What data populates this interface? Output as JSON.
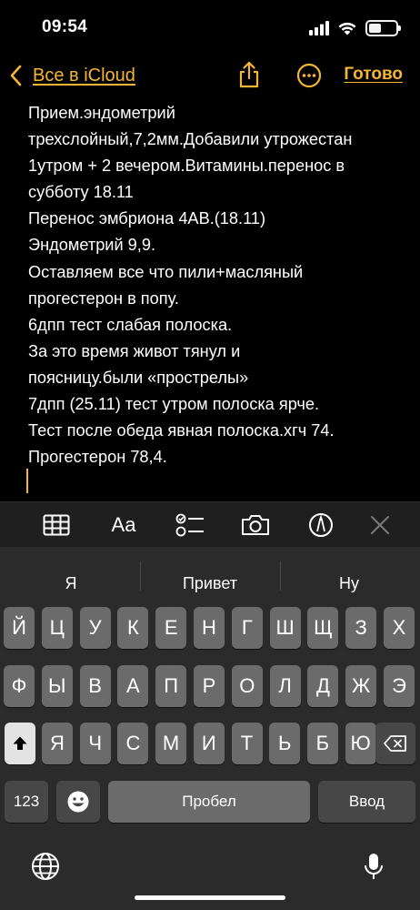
{
  "status_bar": {
    "time": "09:54",
    "battery_level": 0.45
  },
  "nav": {
    "back_label": "Все в iCloud",
    "done_label": "Готово"
  },
  "note": {
    "lines": [
      "Прием.эндометрий",
      "трехслойный,7,2мм.Добавили утрожестан",
      "1утром + 2 вечером.Витамины.перенос в",
      "субботу 18.11",
      "Перенос эмбриона 4АВ.(18.11)",
      "Эндометрий 9,9.",
      "Оставляем все что пили+масляный",
      "прогестерон в попу.",
      "6дпп тест слабая полоска.",
      "За это время живот тянул и",
      "поясницу.были «прострелы»",
      "7дпп  (25.11) тест утром полоска ярче.",
      "Тест после обеда явная полоска.хгч 74.",
      "Прогестерон 78,4."
    ]
  },
  "format_toolbar": {
    "items": [
      "table-icon",
      "Aa",
      "checklist-icon",
      "camera-icon",
      "markup-icon",
      "close-icon"
    ],
    "format_label": "Aa"
  },
  "keyboard": {
    "suggestions": [
      "Я",
      "Привет",
      "Ну"
    ],
    "row1": [
      "Й",
      "Ц",
      "У",
      "К",
      "Е",
      "Н",
      "Г",
      "Ш",
      "Щ",
      "З",
      "Х"
    ],
    "row2": [
      "Ф",
      "Ы",
      "В",
      "А",
      "П",
      "Р",
      "О",
      "Л",
      "Д",
      "Ж",
      "Э"
    ],
    "row3": [
      "Я",
      "Ч",
      "С",
      "М",
      "И",
      "Т",
      "Ь",
      "Б",
      "Ю"
    ],
    "numbers_label": "123",
    "space_label": "Пробел",
    "return_label": "Ввод"
  },
  "colors": {
    "accent": "#f5b731",
    "background": "#000000",
    "keyboard_bg": "#2b2b2b",
    "key": "#6b6b6b",
    "key_dark": "#474747"
  }
}
